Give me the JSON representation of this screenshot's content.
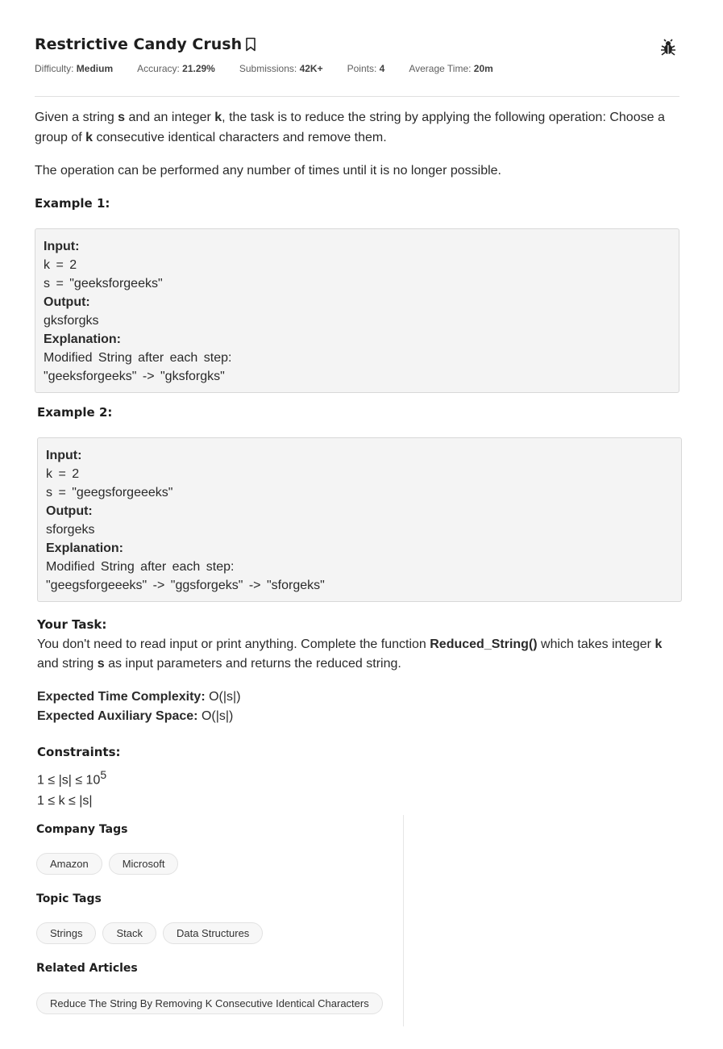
{
  "problem": {
    "title": "Restrictive Candy Crush",
    "stats": [
      {
        "label": "Difficulty: ",
        "value": "Medium"
      },
      {
        "label": "Accuracy: ",
        "value": "21.29%"
      },
      {
        "label": "Submissions: ",
        "value": "42K+"
      },
      {
        "label": "Points: ",
        "value": "4"
      },
      {
        "label": "Average Time: ",
        "value": "20m"
      }
    ]
  },
  "description": {
    "p1_a": "Given a string ",
    "p1_s": "s",
    "p1_b": " and an integer ",
    "p1_k": "k",
    "p1_c": ", the task is to reduce the string by applying the following operation: Choose a group of ",
    "p1_k2": "k",
    "p1_d": " consecutive identical characters and remove them.",
    "p2": "The operation can be performed any number of times until it is no longer possible."
  },
  "examples": [
    {
      "heading": "Example 1:",
      "input_label": "Input:",
      "input_k": "k = 2",
      "input_s": "s = \"geeksforgeeks\"",
      "output_label": "Output:",
      "output": "gksforgks",
      "explanation_label": "Explanation:",
      "explanation": "Modified String after each step:",
      "steps": "\"geeksforgeeks\" -> \"gksforgks\""
    },
    {
      "heading": "Example 2:",
      "input_label": "Input:",
      "input_k": "k = 2",
      "input_s": "s = \"geegsforgeeeks\"",
      "output_label": "Output:",
      "output": "sforgeks",
      "explanation_label": "Explanation:",
      "explanation": "Modified String after each step:",
      "steps": "\"geegsforgeeeks\" -> \"ggsforgeks\" -> \"sforgeks\""
    }
  ],
  "task": {
    "heading": "Your Task:",
    "text_a": "You don't need to read input or print anything. Complete the function ",
    "fn": "Reduced_String()",
    "text_b": " which takes integer ",
    "k": "k",
    "text_c": " and string ",
    "s": "s",
    "text_d": " as input parameters and returns the reduced string."
  },
  "complexity": {
    "time_label": "Expected Time Complexity:",
    "time_value": " O(|s|)",
    "space_label": "Expected Auxiliary Space:",
    "space_value": " O(|s|)"
  },
  "constraints": {
    "heading": "Constraints:",
    "c1": "1 ≤ |s| ≤ 10",
    "c1_exp": "5",
    "c2": "1 ≤ k ≤ |s|"
  },
  "company_tags": {
    "heading": "Company Tags",
    "items": [
      "Amazon",
      "Microsoft"
    ]
  },
  "topic_tags": {
    "heading": "Topic Tags",
    "items": [
      "Strings",
      "Stack",
      "Data Structures"
    ]
  },
  "related": {
    "heading": "Related Articles",
    "items": [
      "Reduce The String By Removing K Consecutive Identical Characters"
    ]
  },
  "icons": {
    "bookmark": "bookmark-icon",
    "bug": "bug-icon"
  }
}
